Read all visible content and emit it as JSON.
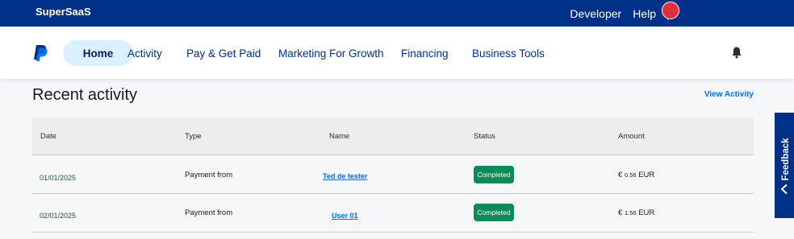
{
  "topbar": {
    "brand": "SuperSaaS",
    "developer": "Developer",
    "help": "Help"
  },
  "nav": {
    "home": "Home",
    "activity": "Activity",
    "pay": "Pay & Get Paid",
    "marketing": "Marketing For Growth",
    "financing": "Financing",
    "tools": "Business Tools"
  },
  "section": {
    "title": "Recent activity",
    "view_link": "View Activity"
  },
  "table": {
    "headers": [
      "Date",
      "Type",
      "Name",
      "Status",
      "Amount"
    ],
    "rows": [
      {
        "date": "01/01/2025",
        "type": "Payment from",
        "name": "Ted de tester",
        "status": "Completed",
        "currency_symbol": "€",
        "amount": "0.56",
        "currency": "EUR"
      },
      {
        "date": "02/01/2025",
        "type": "Payment from",
        "name": "User 01",
        "status": "Completed",
        "currency_symbol": "€",
        "amount": "1.56",
        "currency": "EUR"
      }
    ]
  },
  "feedback": {
    "label": "Feedback"
  },
  "colors": {
    "brand_navy": "#003087",
    "link_blue": "#0070e0",
    "status_green": "#0d8a5a",
    "avatar_red": "#e0303f"
  }
}
